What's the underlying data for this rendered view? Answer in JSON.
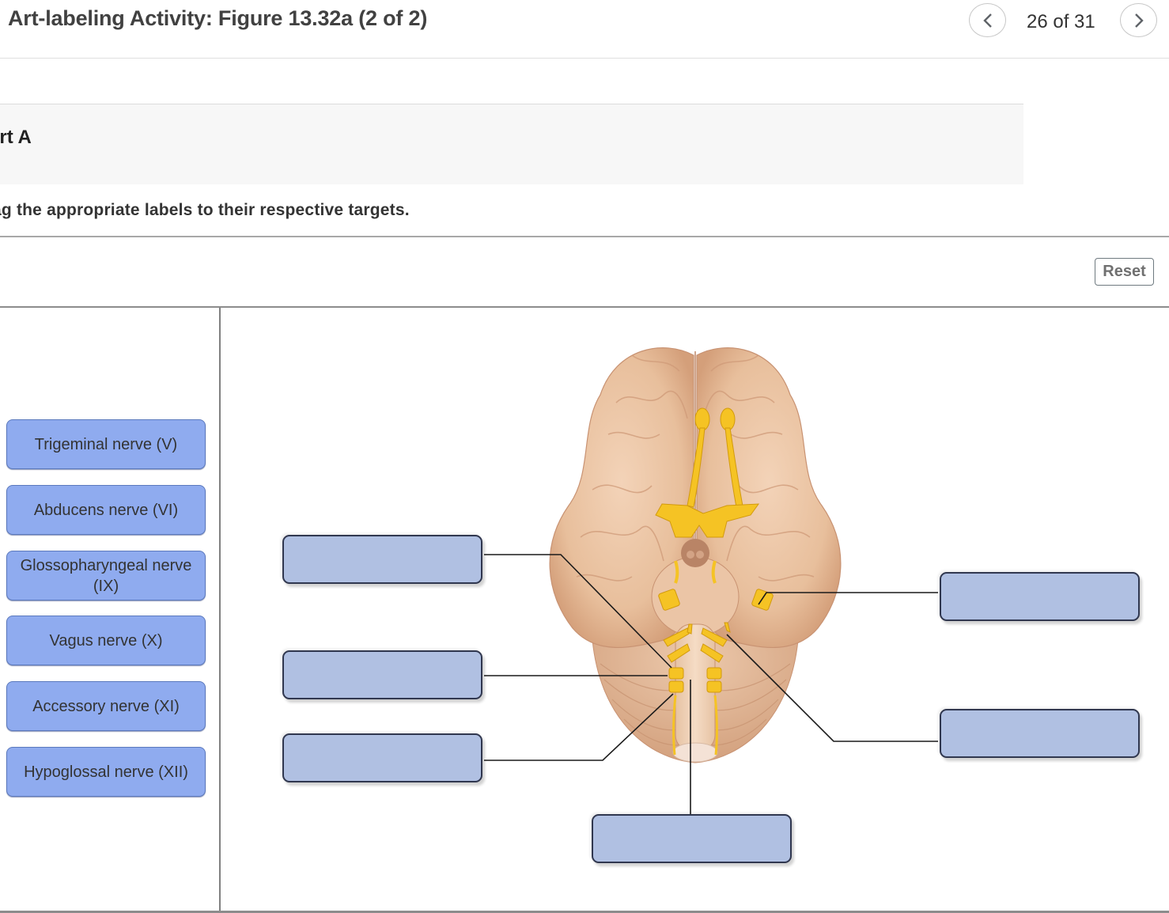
{
  "header": {
    "title": "Art-labeling Activity: Figure 13.32a (2 of 2)",
    "counter": "26 of 31",
    "prev_icon": "chevron-left-icon",
    "next_icon": "chevron-right-icon"
  },
  "part": {
    "title": "art A",
    "instructions": "ag the appropriate labels to their respective targets."
  },
  "toolbar": {
    "reset_label": "Reset"
  },
  "labels": [
    "Trigeminal nerve (V)",
    "Abducens nerve (VI)",
    "Glossopharyngeal nerve (IX)",
    "Vagus nerve (X)",
    "Accessory nerve (XI)",
    "Hypoglossal nerve (XII)"
  ],
  "targets": [
    {
      "id": "left-top",
      "value": ""
    },
    {
      "id": "left-middle",
      "value": ""
    },
    {
      "id": "left-bottom",
      "value": ""
    },
    {
      "id": "right-top",
      "value": ""
    },
    {
      "id": "right-bottom",
      "value": ""
    },
    {
      "id": "bottom-center",
      "value": ""
    }
  ],
  "colors": {
    "label_fill": "#8fabef",
    "target_fill": "#b0c0e2",
    "nerve": "#f5c324",
    "brain": "#e9bf9e"
  }
}
